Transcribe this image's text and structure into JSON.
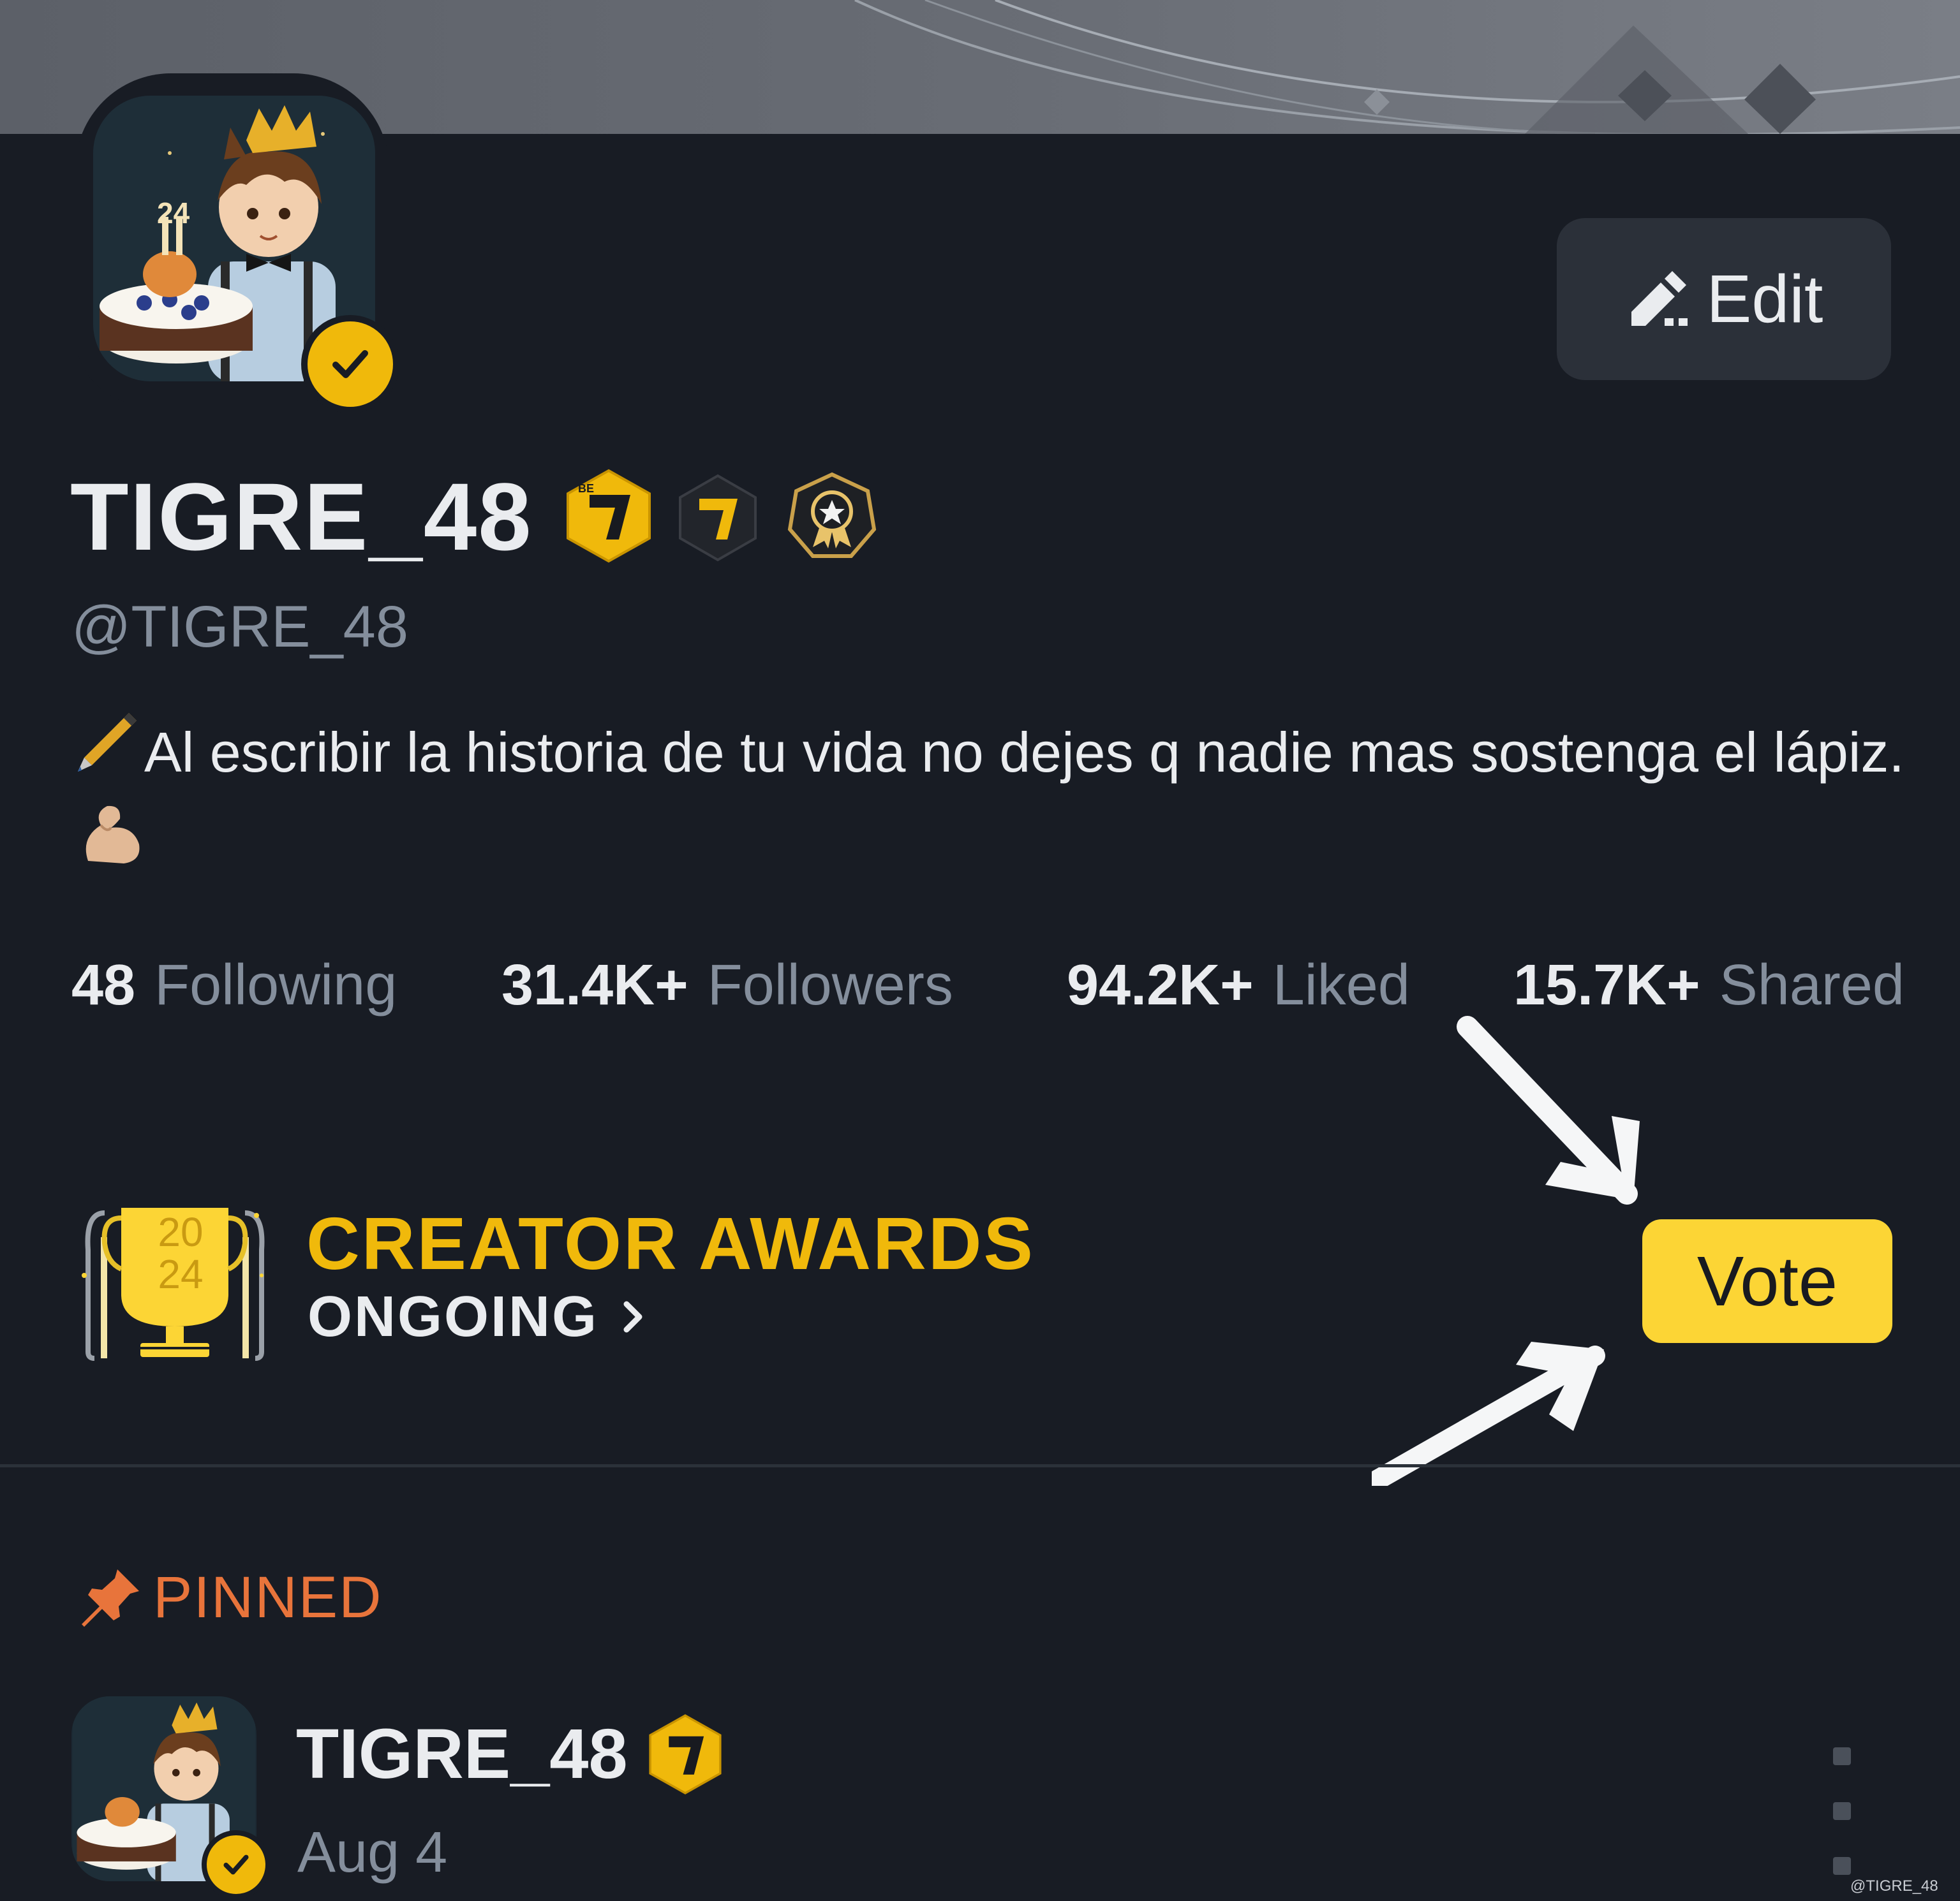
{
  "profile": {
    "display_name": "TIGRE_48",
    "username": "@TIGRE_48",
    "bio": "Al escribir la historia de tu vida no dejes q nadie mas sostenga el lápiz.",
    "bio_emoji_start": "pen-icon",
    "bio_emoji_end": "flexed-biceps-icon",
    "edit_label": "Edit",
    "badges": [
      "be7-binance-gold-badge",
      "be7-binance-dark-badge",
      "award-medal-badge"
    ]
  },
  "stats": [
    {
      "value": "48",
      "label": "Following"
    },
    {
      "value": "31.4K+",
      "label": "Followers"
    },
    {
      "value": "94.2K+",
      "label": "Liked"
    },
    {
      "value": "15.7K+",
      "label": "Shared"
    }
  ],
  "awards": {
    "trophy_year_top": "20",
    "trophy_year_bottom": "24",
    "title": "CREATOR AWARDS",
    "status": "ONGOING",
    "vote_label": "Vote"
  },
  "pinned": {
    "label": "PINNED",
    "post": {
      "author": "TIGRE_48",
      "date": "Aug 4"
    }
  },
  "watermark": "@TIGRE_48",
  "colors": {
    "background": "#181c24",
    "accent_yellow": "#fcd535",
    "brand_gold": "#f0b90b",
    "pinned_orange": "#e8743b",
    "muted_text": "#848e9c"
  }
}
